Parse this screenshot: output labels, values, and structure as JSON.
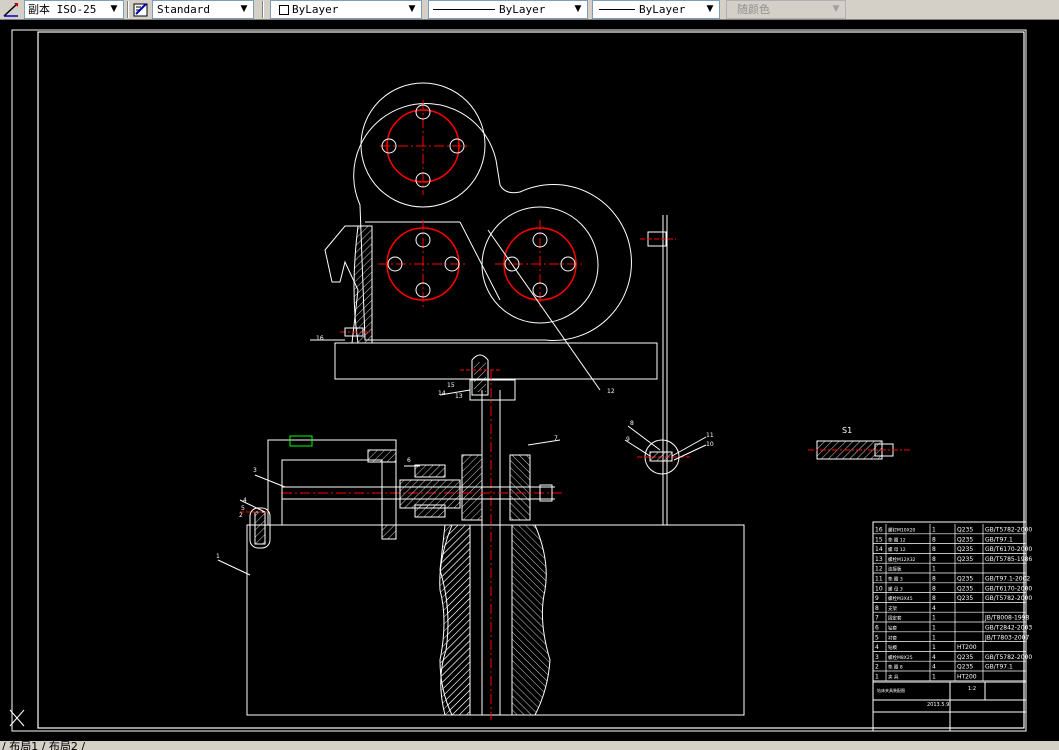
{
  "toolbar": {
    "dimstyle": "副本 ISO-25",
    "textstyle": "Standard",
    "layer": "ByLayer",
    "linetype": "ByLayer",
    "lineweight": "ByLayer",
    "plotstyle": "随颜色"
  },
  "tabs": "/ 布局1 / 布局2 /",
  "colors": {
    "background": "#000000",
    "lines": "#ffffff",
    "centerlines": "#ff0000",
    "accent": "#00ff00",
    "toolbar": "#d4d0c8"
  },
  "icons": [
    "dimstyle-icon",
    "textstyle-icon",
    "ucs-icon"
  ],
  "drawing": {
    "balloons": [
      "16",
      "15",
      "14",
      "13",
      "12",
      "7",
      "6",
      "3",
      "4",
      "5",
      "2",
      "1",
      "8",
      "9",
      "11",
      "10"
    ],
    "section_label": "S1"
  },
  "bom": {
    "rows": [
      {
        "no": "16",
        "name": "螺钉M10X20",
        "qty": "1",
        "mat": "Q235",
        "std": "GB/T5782-2000"
      },
      {
        "no": "15",
        "name": "垫 圈 12",
        "qty": "8",
        "mat": "Q235",
        "std": "GB/T97.1"
      },
      {
        "no": "14",
        "name": "螺 母 12",
        "qty": "8",
        "mat": "Q235",
        "std": "GB/T6170-2000"
      },
      {
        "no": "13",
        "name": "螺栓M12X32",
        "qty": "8",
        "mat": "Q235",
        "std": "GB/T5785-1986"
      },
      {
        "no": "12",
        "name": "连接板",
        "qty": "1",
        "mat": "",
        "std": ""
      },
      {
        "no": "11",
        "name": "垫 圈 3",
        "qty": "8",
        "mat": "Q235",
        "std": "GB/T97.1-2002"
      },
      {
        "no": "10",
        "name": "螺 母 3",
        "qty": "8",
        "mat": "Q235",
        "std": "GB/T6170-2000"
      },
      {
        "no": "9",
        "name": "螺栓M3X45",
        "qty": "8",
        "mat": "Q235",
        "std": "GB/T5782-2000"
      },
      {
        "no": "8",
        "name": "支架",
        "qty": "4",
        "mat": "",
        "std": ""
      },
      {
        "no": "7",
        "name": "固定套",
        "qty": "1",
        "mat": "",
        "std": "JB/T8008-1998"
      },
      {
        "no": "6",
        "name": "钻套",
        "qty": "1",
        "mat": "",
        "std": "GB/T2842-2003"
      },
      {
        "no": "5",
        "name": "衬套",
        "qty": "1",
        "mat": "",
        "std": "JB/T7803-2007"
      },
      {
        "no": "4",
        "name": "钻模",
        "qty": "1",
        "mat": "HT200",
        "std": ""
      },
      {
        "no": "3",
        "name": "螺栓M8X25",
        "qty": "4",
        "mat": "Q235",
        "std": "GB/T5782-2000"
      },
      {
        "no": "2",
        "name": "垫 圈 8",
        "qty": "4",
        "mat": "Q235",
        "std": "GB/T97.1"
      },
      {
        "no": "1",
        "name": "夹 具",
        "qty": "1",
        "mat": "HT200",
        "std": ""
      }
    ],
    "title": {
      "drawing_no": "钻床夹具装配图",
      "date": "2013.5.9",
      "scale": "1:2"
    }
  }
}
